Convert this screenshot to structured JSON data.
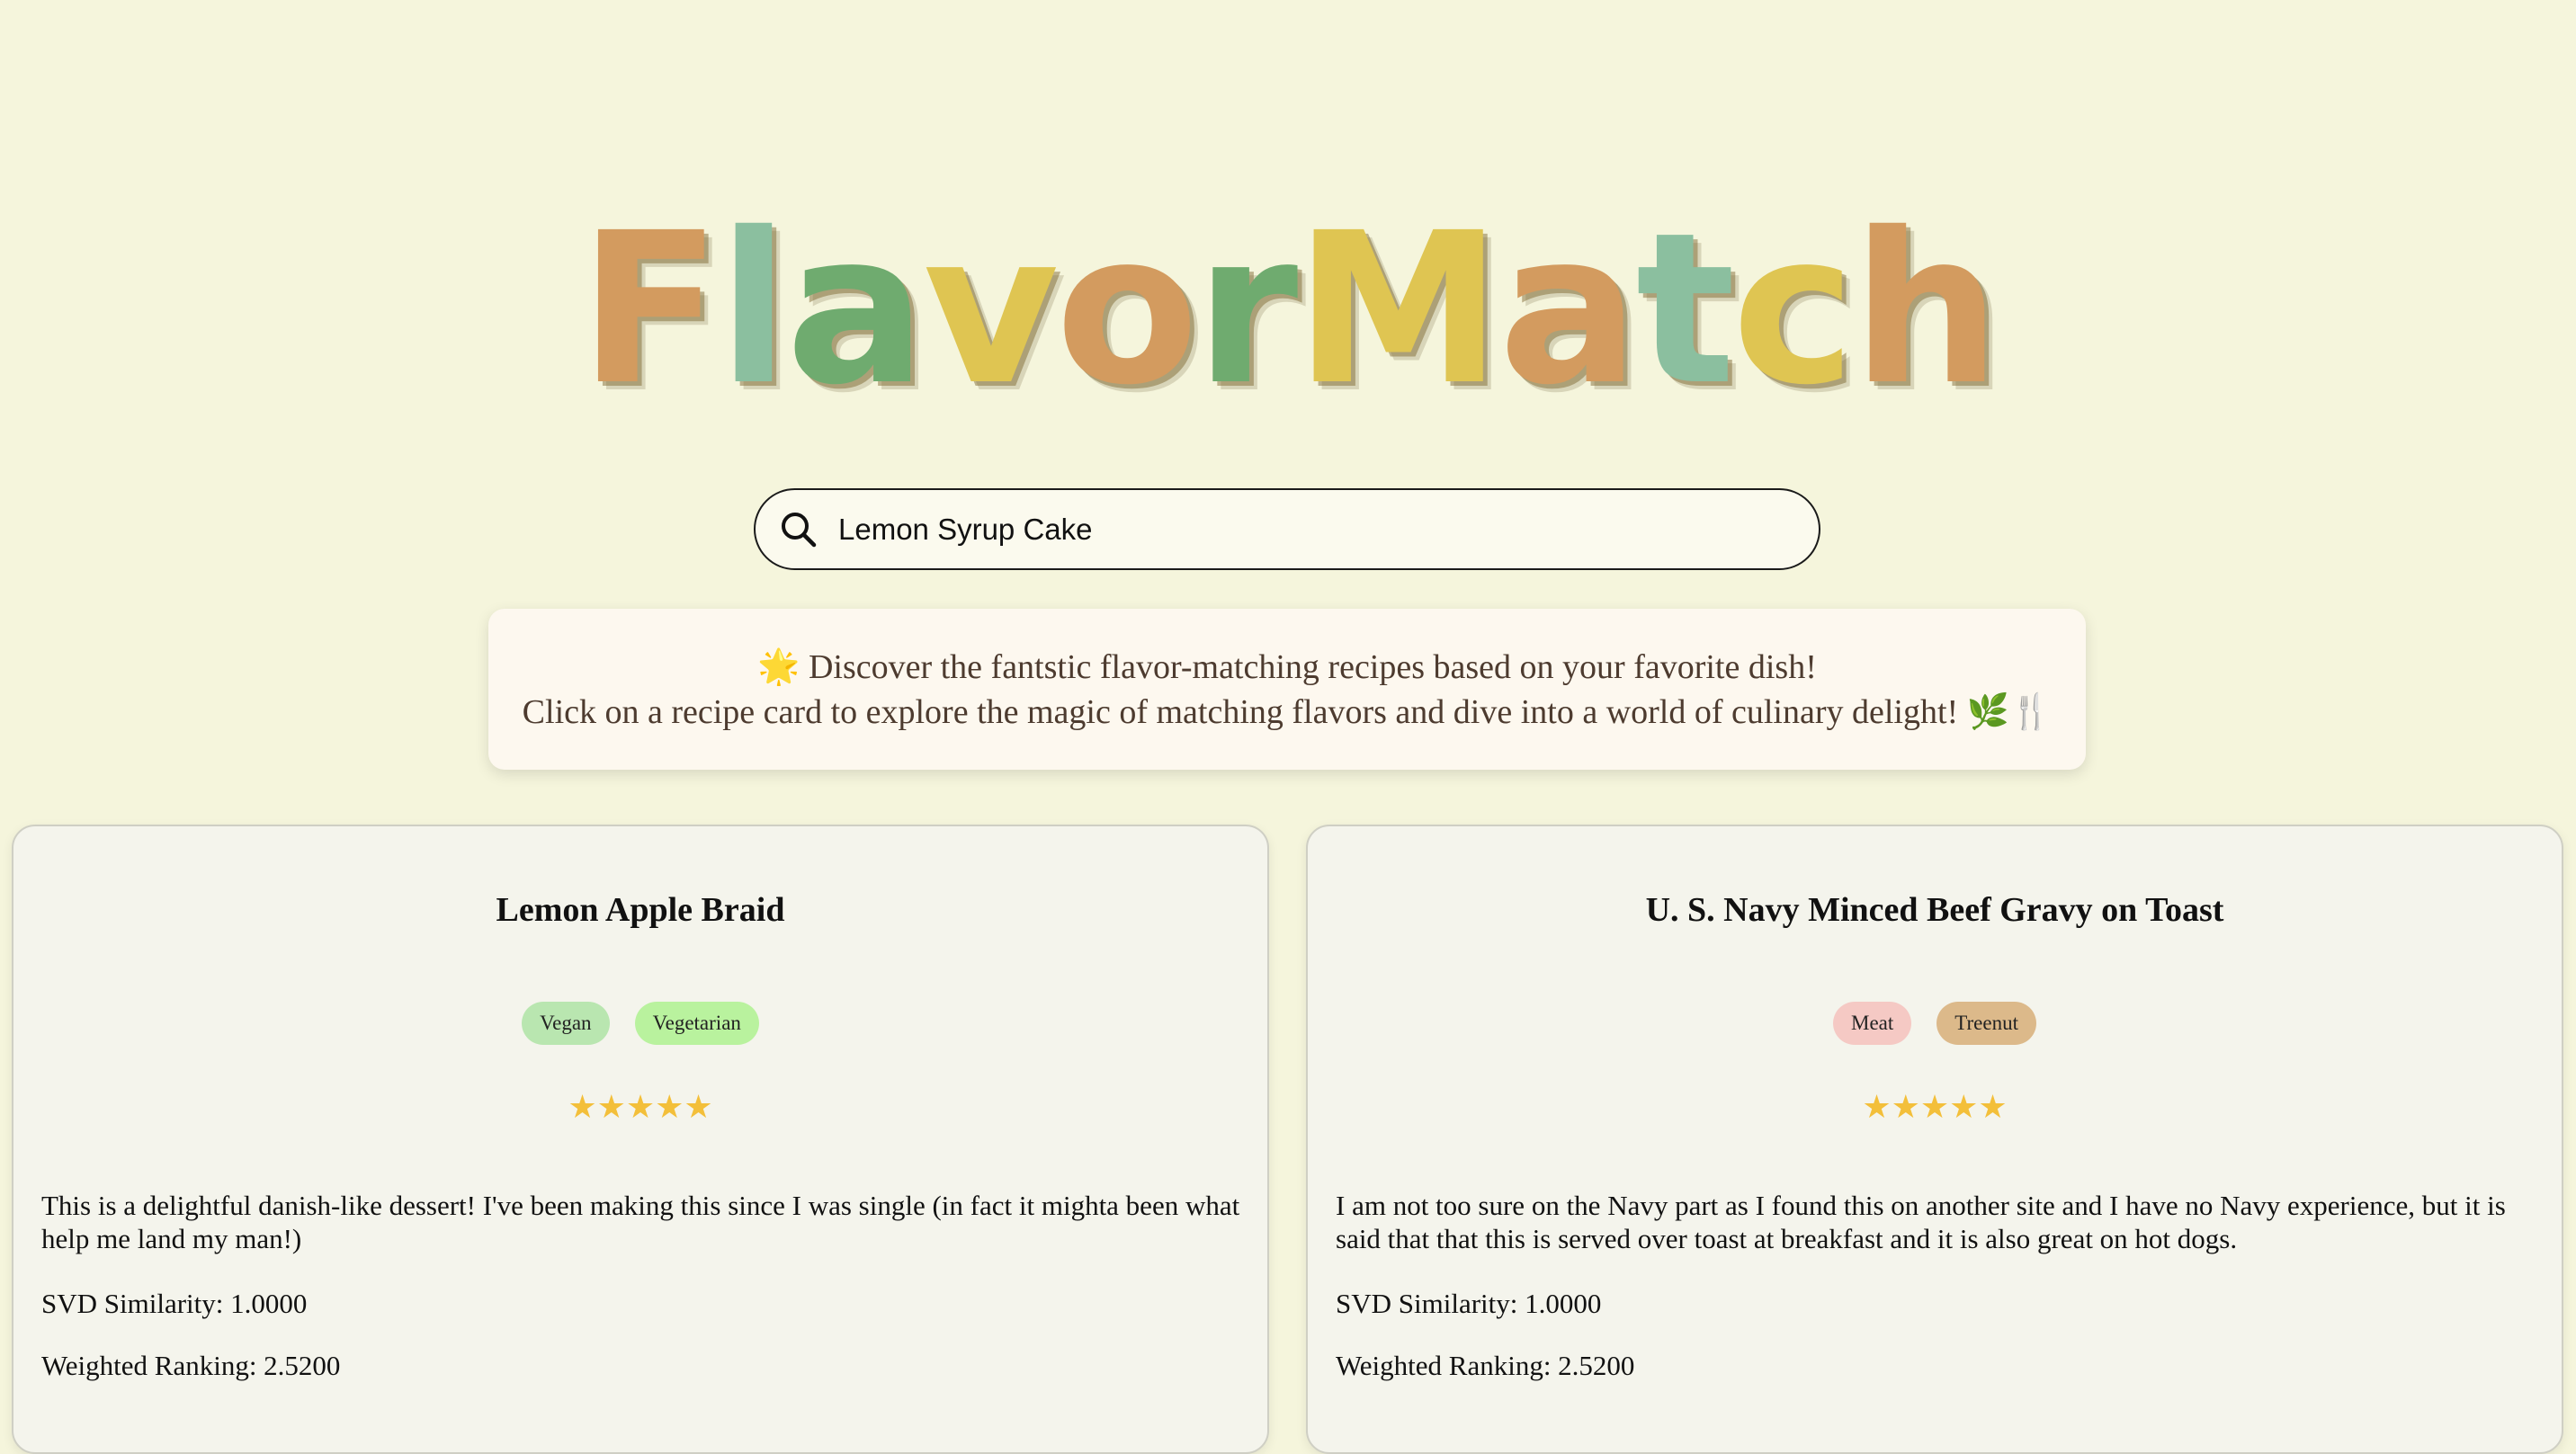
{
  "brand": {
    "letters": [
      {
        "char": "F",
        "color": "#d39b5f"
      },
      {
        "char": "l",
        "color": "#8bbf9f"
      },
      {
        "char": "a",
        "color": "#6fab6f"
      },
      {
        "char": "v",
        "color": "#dfc552"
      },
      {
        "char": "o",
        "color": "#d39b5f"
      },
      {
        "char": "r",
        "color": "#6fab6f"
      },
      {
        "char": "M",
        "color": "#dfc552"
      },
      {
        "char": "a",
        "color": "#d39b5f"
      },
      {
        "char": "t",
        "color": "#8bbf9f"
      },
      {
        "char": "c",
        "color": "#dfc552"
      },
      {
        "char": "h",
        "color": "#d39b5f"
      }
    ]
  },
  "search": {
    "value": "Lemon Syrup Cake",
    "icon": "search-icon"
  },
  "intro": {
    "line1": "🌟 Discover the fantstic flavor-matching recipes based on your favorite dish!",
    "line2": "Click on a recipe card to explore the magic of matching flavors and dive into a world of culinary delight! 🌿🍴"
  },
  "recipes": [
    {
      "title": "Lemon Apple Braid",
      "tags": [
        {
          "label": "Vegan",
          "color": "#b9e6b0"
        },
        {
          "label": "Vegetarian",
          "color": "#b9f29e"
        }
      ],
      "rating": 5,
      "stars": "★★★★★",
      "description": "This is a delightful danish-like dessert! I've been making this since I was single (in fact it mighta been what help me land my man!)",
      "svd": "SVD Similarity: 1.0000",
      "weighted": "Weighted Ranking: 2.5200"
    },
    {
      "title": "U. S. Navy Minced Beef Gravy on Toast",
      "tags": [
        {
          "label": "Meat",
          "color": "#f5c9c4"
        },
        {
          "label": "Treenut",
          "color": "#dcb98a"
        }
      ],
      "rating": 5,
      "stars": "★★★★★",
      "description": "I am not too sure on the Navy part as I found this on another site and I have no Navy experience, but it is said that that this is served over toast at breakfast and it is also great on hot dogs.",
      "svd": "SVD Similarity: 1.0000",
      "weighted": "Weighted Ranking: 2.5200"
    }
  ]
}
